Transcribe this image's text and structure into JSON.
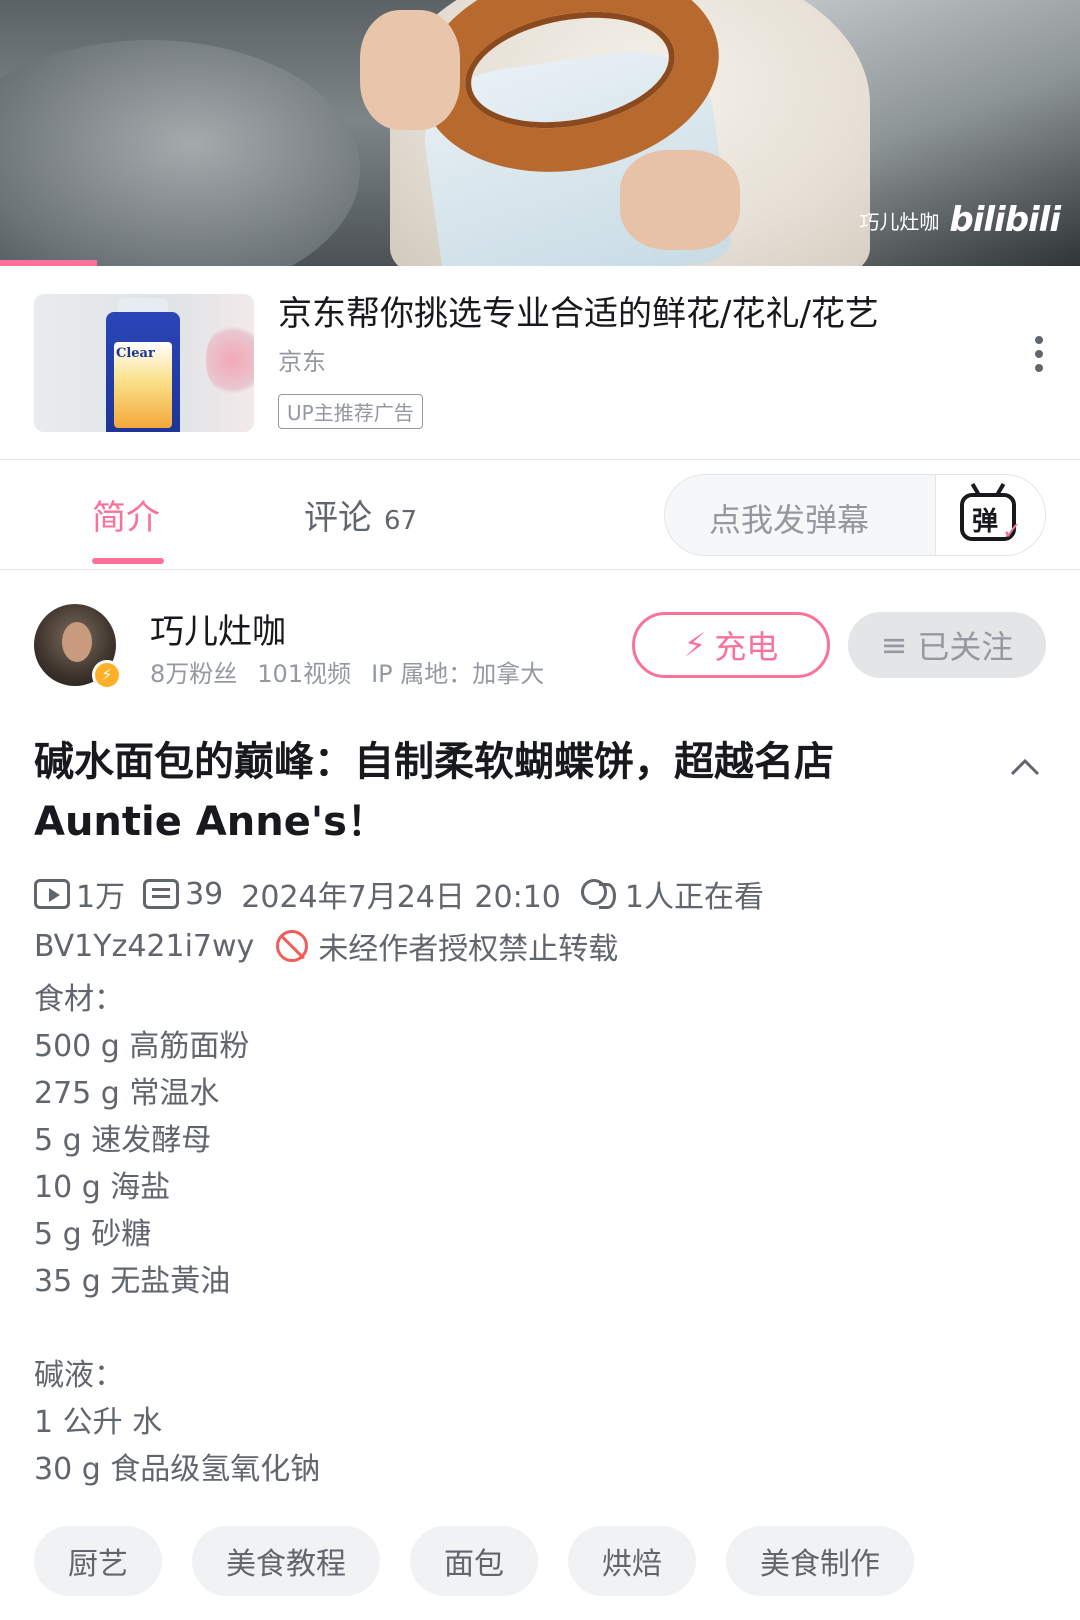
{
  "video": {
    "uploader_watermark": "巧儿灶咖",
    "platform_logo": "bilibili",
    "progress": 0.09
  },
  "ad": {
    "thumbnail_text": "Clear",
    "title": "京东帮你挑选专业合适的鲜花/花礼/花艺",
    "brand": "京东",
    "tag": "UP主推荐广告",
    "more_icon": "more-vertical-icon"
  },
  "tabs": {
    "intro": "简介",
    "comments": "评论",
    "comments_count": "67",
    "danmaku_placeholder": "点我发弹幕",
    "danmaku_icon_char": "弹"
  },
  "uploader": {
    "name": "巧儿灶咖",
    "fans": "8万粉丝",
    "videos": "101视频",
    "ip": "IP 属地：加拿大",
    "badge_icon": "lightning-icon",
    "charge_label": "充电",
    "follow_label": "已关注"
  },
  "video_info": {
    "title": "碱水面包的巅峰：自制柔软蝴蝶饼，超越名店 Auntie Anne's！",
    "views": "1万",
    "danmaku_count": "39",
    "date": "2024年7月24日 20:10",
    "watching": "1人正在看",
    "bvid": "BV1Yz421i7wy",
    "no_repost": "未经作者授权禁止转载"
  },
  "description": {
    "lines": [
      "食材：",
      "500 g 高筋面粉",
      "275 g 常温水",
      "5 g 速发酵母",
      "10 g 海盐",
      "5 g 砂糖",
      "35 g 无盐黃油",
      "",
      "碱液：",
      "1 公升 水",
      "30 g 食品级氢氧化钠"
    ]
  },
  "tags": [
    "厨艺",
    "美食教程",
    "面包",
    "烘焙",
    "美食制作"
  ],
  "colors": {
    "accent": "#fb7299",
    "text_primary": "#18191c",
    "text_secondary": "#61666d",
    "text_muted": "#9499a0",
    "warning": "#f25d59"
  }
}
